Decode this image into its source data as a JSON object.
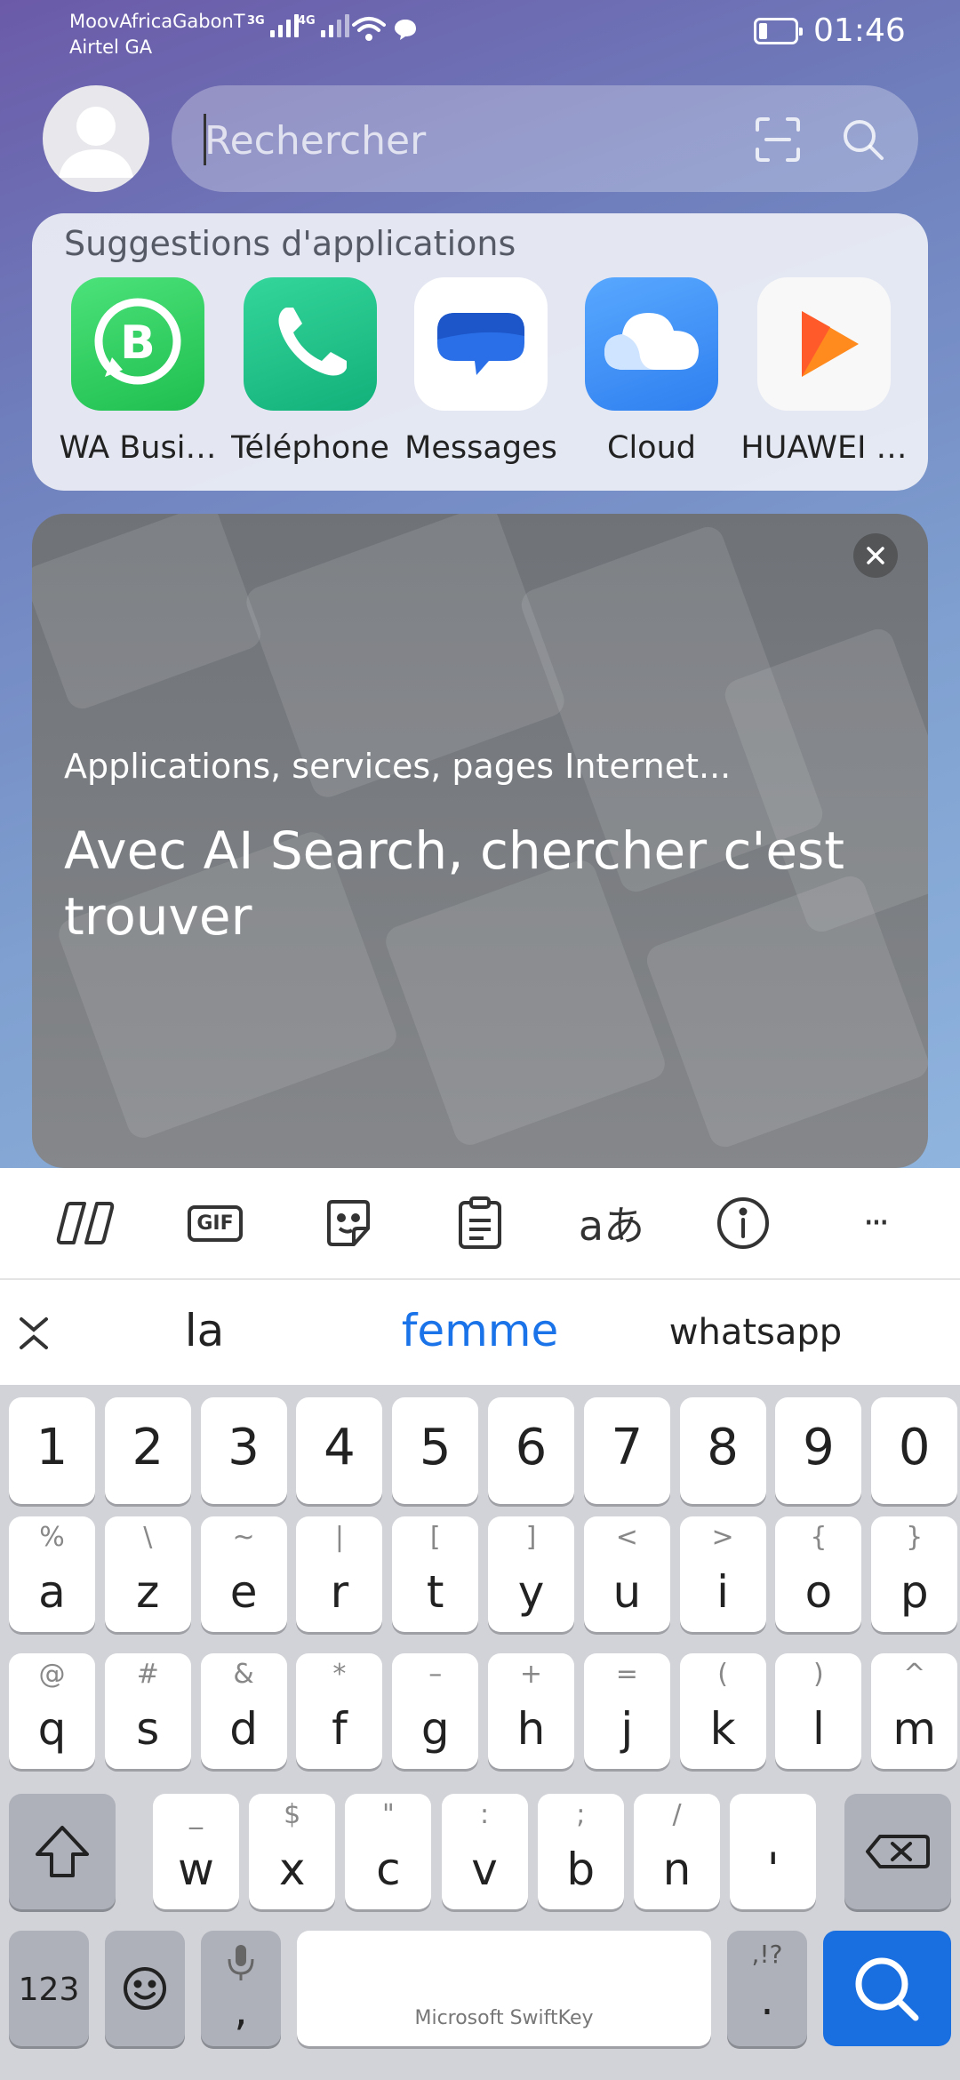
{
  "status_bar": {
    "carrier_1": "MoovAfricaGabonT",
    "carrier_2": "Airtel GA",
    "net_1": "3G",
    "net_2": "4G",
    "time": "01:46"
  },
  "search": {
    "placeholder": "Rechercher"
  },
  "suggestions": {
    "title": "Suggestions d'applications",
    "apps": [
      {
        "label": "WA Busi…",
        "icon": "whatsapp-business-icon",
        "color": "#25d366"
      },
      {
        "label": "Téléphone",
        "icon": "phone-icon",
        "color": "#1fc889"
      },
      {
        "label": "Messages",
        "icon": "messages-icon",
        "color": "#2a6fe8"
      },
      {
        "label": "Cloud",
        "icon": "cloud-icon",
        "color": "#3d8ff5"
      },
      {
        "label": "HUAWEI …",
        "icon": "huawei-video-icon",
        "color": "#ff7a1a"
      }
    ]
  },
  "banner": {
    "subtitle": "Applications, services, pages Internet...",
    "title": "Avec AI Search, chercher c'est trouver"
  },
  "keyboard_toolbar": {
    "gif_label": "GIF",
    "translate_label": "aあ",
    "more_label": "···"
  },
  "predictions": [
    "la",
    "femme",
    "whatsapp"
  ],
  "keyboard": {
    "row_numbers": [
      "1",
      "2",
      "3",
      "4",
      "5",
      "6",
      "7",
      "8",
      "9",
      "0"
    ],
    "row_1": [
      [
        "a",
        "%"
      ],
      [
        "z",
        "\\"
      ],
      [
        "e",
        "~"
      ],
      [
        "r",
        "|"
      ],
      [
        "t",
        "["
      ],
      [
        "y",
        "]"
      ],
      [
        "u",
        "<"
      ],
      [
        "i",
        ">"
      ],
      [
        "o",
        "{"
      ],
      [
        "p",
        "}"
      ]
    ],
    "row_2": [
      [
        "q",
        "@"
      ],
      [
        "s",
        "#"
      ],
      [
        "d",
        "&"
      ],
      [
        "f",
        "*"
      ],
      [
        "g",
        "–"
      ],
      [
        "h",
        "+"
      ],
      [
        "j",
        "="
      ],
      [
        "k",
        "("
      ],
      [
        "l",
        ")"
      ],
      [
        "m",
        "^"
      ]
    ],
    "row_3": [
      [
        "w",
        "_"
      ],
      [
        "x",
        "$"
      ],
      [
        "c",
        "\""
      ],
      [
        "v",
        ":"
      ],
      [
        "b",
        ";"
      ],
      [
        "n",
        "/"
      ],
      [
        "'",
        ""
      ]
    ],
    "numbers_label": "123",
    "comma": ",",
    "space_label": "Microsoft SwiftKey",
    "period": ".",
    "period_alt": ",!?"
  },
  "colors": {
    "accent": "#1a73e8",
    "search_key": "#1a6fe0"
  }
}
